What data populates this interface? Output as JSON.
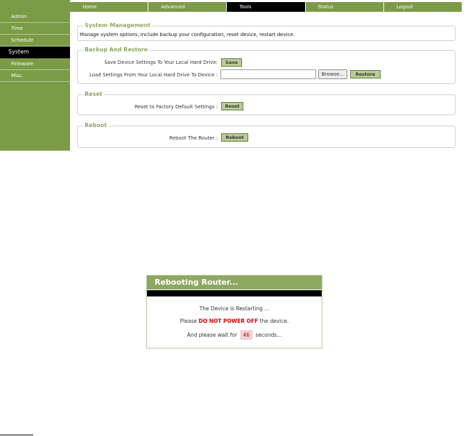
{
  "nav": {
    "tabs": [
      {
        "label": "Home"
      },
      {
        "label": "Advanced"
      },
      {
        "label": "Tools",
        "active": true
      },
      {
        "label": "Status"
      },
      {
        "label": "Logout"
      }
    ]
  },
  "sidebar": {
    "items": [
      {
        "label": "Admin"
      },
      {
        "label": "Time"
      },
      {
        "label": "Schedule"
      },
      {
        "label": "System",
        "active": true
      },
      {
        "label": "Firmware"
      },
      {
        "label": "Misc."
      }
    ]
  },
  "system_management": {
    "title": "System Management",
    "description": "Manage system options, include backup your configuration, reset device, restart device."
  },
  "backup": {
    "title": "Backup And Restore",
    "save_label": "Save Device Settings To Your Local Hard Drive:",
    "save_button": "Save",
    "load_label": "Load Settings From Your Local Hard Drive To Device :",
    "file_value": "",
    "browse_button": "Browse...",
    "restore_button": "Restore"
  },
  "reset": {
    "title": "Reset",
    "label": "Reset to Factory Default Settings :",
    "button": "Reset"
  },
  "reboot": {
    "title": "Reboot",
    "label": "Reboot The Router :",
    "button": "Reboot"
  },
  "dialog": {
    "title": "Rebooting Router...",
    "line1": "The Device is Restarting ...",
    "line2_prefix": "Please ",
    "line2_warning": "DO NOT POWER OFF",
    "line2_suffix": " the device.",
    "line3_prefix": "And please wait for ",
    "countdown": "46",
    "line3_suffix": " seconds..."
  },
  "colors": {
    "brand_green": "#7b9b47",
    "legend_green": "#8aa862",
    "warning_red": "#e00000"
  }
}
